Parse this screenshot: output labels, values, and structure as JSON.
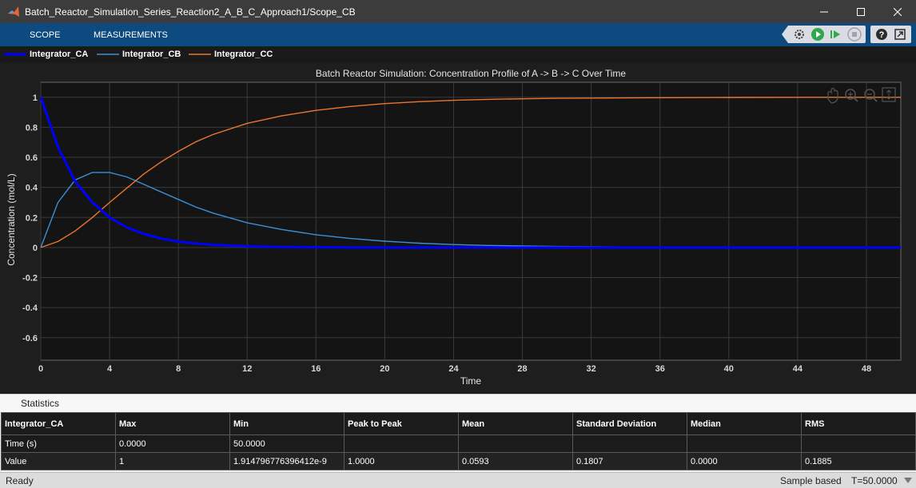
{
  "window": {
    "title": "Batch_Reactor_Simulation_Series_Reaction2_A_B_C_Approach1/Scope_CB"
  },
  "toolstrip": {
    "tabs": [
      "SCOPE",
      "MEASUREMENTS"
    ],
    "buttons": [
      "settings-icon",
      "run-icon",
      "step-forward-icon",
      "stop-icon",
      "help-icon",
      "undock-icon"
    ]
  },
  "legend": [
    {
      "name": "Integrator_CA",
      "color": "#0000ff"
    },
    {
      "name": "Integrator_CB",
      "color": "#3a8fd8"
    },
    {
      "name": "Integrator_CC",
      "color": "#e8772e"
    }
  ],
  "chart_data": {
    "type": "line",
    "title": "Batch Reactor Simulation: Concentration Profile of A -> B -> C Over Time",
    "xlabel": "Time",
    "ylabel": "Concentration (mol/L)",
    "xlim": [
      0,
      50
    ],
    "ylim": [
      -0.75,
      1.1
    ],
    "xticks": [
      0,
      4,
      8,
      12,
      16,
      20,
      24,
      28,
      32,
      36,
      40,
      44,
      48
    ],
    "yticks": [
      -0.6,
      -0.4,
      -0.2,
      0,
      0.2,
      0.4,
      0.6,
      0.8,
      1
    ],
    "grid": true,
    "x": [
      0,
      1,
      2,
      3,
      4,
      5,
      6,
      7,
      8,
      9,
      10,
      12,
      14,
      16,
      18,
      20,
      22,
      24,
      26,
      28,
      30,
      35,
      40,
      45,
      50
    ],
    "series": [
      {
        "name": "Integrator_CA",
        "color": "#0000ff",
        "values": [
          1,
          0.67,
          0.44,
          0.3,
          0.2,
          0.135,
          0.09,
          0.06,
          0.04,
          0.027,
          0.018,
          0.008,
          0.004,
          0.002,
          0.001,
          0.0005,
          0,
          0,
          0,
          0,
          0,
          0,
          0,
          0,
          0
        ]
      },
      {
        "name": "Integrator_CB",
        "color": "#3a8fd8",
        "values": [
          0,
          0.3,
          0.45,
          0.5,
          0.5,
          0.47,
          0.42,
          0.37,
          0.32,
          0.27,
          0.23,
          0.165,
          0.12,
          0.085,
          0.06,
          0.042,
          0.029,
          0.02,
          0.014,
          0.01,
          0.007,
          0.003,
          0.001,
          0.0005,
          0
        ]
      },
      {
        "name": "Integrator_CC",
        "color": "#e8772e",
        "values": [
          0,
          0.04,
          0.11,
          0.2,
          0.3,
          0.395,
          0.49,
          0.57,
          0.64,
          0.703,
          0.752,
          0.827,
          0.876,
          0.913,
          0.939,
          0.958,
          0.971,
          0.98,
          0.986,
          0.99,
          0.993,
          0.997,
          0.999,
          1,
          1
        ]
      }
    ]
  },
  "statistics": {
    "section_label": "Statistics",
    "headers": [
      "Integrator_CA",
      "Max",
      "Min",
      "Peak to Peak",
      "Mean",
      "Standard Deviation",
      "Median",
      "RMS"
    ],
    "rows": [
      [
        "Time (s)",
        "0.0000",
        "50.0000",
        "",
        "",
        "",
        "",
        ""
      ],
      [
        "Value",
        "1",
        "1.914796776396412e-9",
        "1.0000",
        "0.0593",
        "0.1807",
        "0.0000",
        "0.1885"
      ]
    ]
  },
  "status": {
    "left": "Ready",
    "mode": "Sample based",
    "time": "T=50.0000"
  }
}
